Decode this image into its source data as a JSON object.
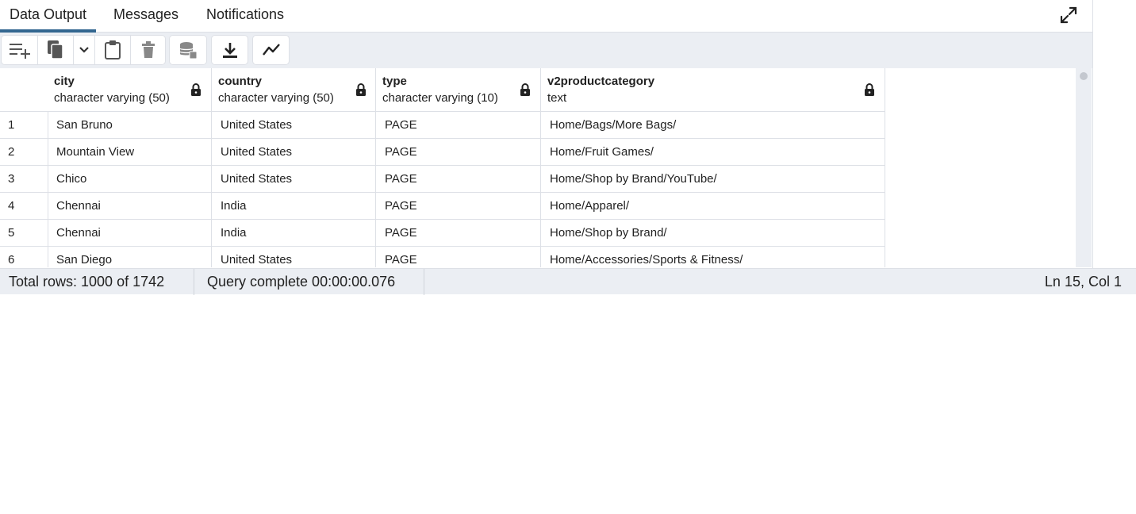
{
  "tabs": [
    {
      "label": "Data Output",
      "active": true
    },
    {
      "label": "Messages",
      "active": false
    },
    {
      "label": "Notifications",
      "active": false
    }
  ],
  "toolbar": {
    "buttons": [
      "add-row-icon",
      "copy-icon",
      "chevron-down-icon",
      "paste-icon",
      "delete-icon",
      "save-data-icon",
      "download-icon",
      "graph-icon"
    ]
  },
  "grid": {
    "columns": [
      {
        "name": "city",
        "type": "character varying (50)"
      },
      {
        "name": "country",
        "type": "character varying (50)"
      },
      {
        "name": "type",
        "type": "character varying (10)"
      },
      {
        "name": "v2productcategory",
        "type": "text"
      }
    ],
    "rows": [
      {
        "num": "1",
        "cells": [
          "San Bruno",
          "United States",
          "PAGE",
          "Home/Bags/More Bags/"
        ]
      },
      {
        "num": "2",
        "cells": [
          "Mountain View",
          "United States",
          "PAGE",
          "Home/Fruit Games/"
        ]
      },
      {
        "num": "3",
        "cells": [
          "Chico",
          "United States",
          "PAGE",
          "Home/Shop by Brand/YouTube/"
        ]
      },
      {
        "num": "4",
        "cells": [
          "Chennai",
          "India",
          "PAGE",
          "Home/Apparel/"
        ]
      },
      {
        "num": "5",
        "cells": [
          "Chennai",
          "India",
          "PAGE",
          "Home/Shop by Brand/"
        ]
      },
      {
        "num": "6",
        "cells": [
          "San Diego",
          "United States",
          "PAGE",
          "Home/Accessories/Sports & Fitness/"
        ]
      }
    ]
  },
  "status": {
    "total_rows": "Total rows: 1000 of 1742",
    "query": "Query complete 00:00:00.076",
    "cursor": "Ln 15, Col 1"
  },
  "colors": {
    "accent": "#326690",
    "toolbar_bg": "#ebeef3",
    "border": "#dde0e6"
  }
}
